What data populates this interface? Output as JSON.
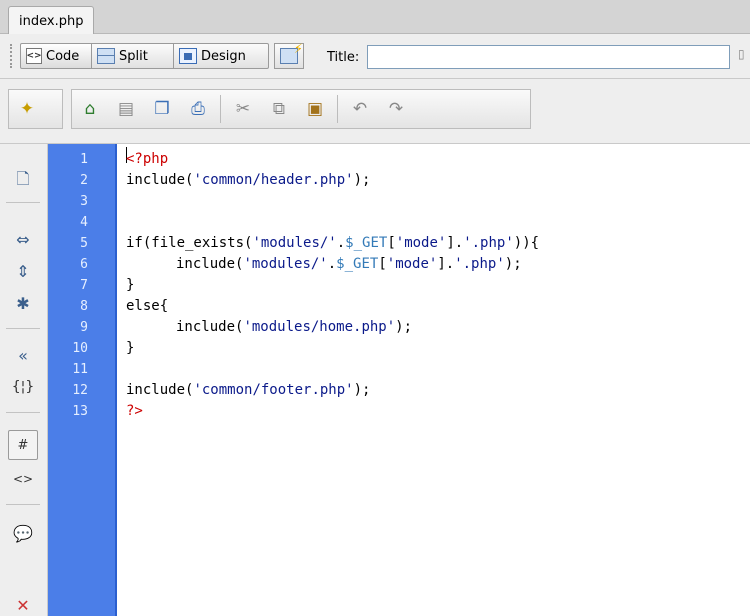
{
  "document": {
    "tab_label": "index.php"
  },
  "view_toolbar": {
    "code_label": "Code",
    "split_label": "Split",
    "design_label": "Design",
    "title_label": "Title:",
    "title_value": ""
  },
  "editor": {
    "lines": [
      {
        "number": "1",
        "text": "<?php"
      },
      {
        "number": "2",
        "text": "include('common/header.php');"
      },
      {
        "number": "3",
        "text": ""
      },
      {
        "number": "4",
        "text": ""
      },
      {
        "number": "5",
        "text": "if(file_exists('modules/'.$_GET['mode'].'.php')){"
      },
      {
        "number": "6",
        "text": "include('modules/'.$_GET['mode'].'.php');"
      },
      {
        "number": "7",
        "text": "}"
      },
      {
        "number": "8",
        "text": "else{"
      },
      {
        "number": "9",
        "text": "include('modules/home.php');"
      },
      {
        "number": "10",
        "text": "}"
      },
      {
        "number": "11",
        "text": ""
      },
      {
        "number": "12",
        "text": "include('common/footer.php');"
      },
      {
        "number": "13",
        "text": "?>"
      }
    ]
  },
  "colors": {
    "gutter_background": "#4b7ee8",
    "php_tag": "#cc0000",
    "string": "#0b1a8a",
    "variable": "#337ab7"
  },
  "icons": {
    "toolbar": [
      "new-document-icon",
      "home-icon",
      "file-management-icon",
      "save-all-icon",
      "print-icon",
      "cut-icon",
      "copy-icon",
      "paste-icon",
      "undo-icon",
      "redo-icon"
    ],
    "sidebar": [
      "open-documents-icon",
      "collapse-full-tag-icon",
      "collapse-selection-icon",
      "expand-all-icon",
      "select-parent-tag-icon",
      "balance-braces-icon",
      "line-numbers-icon",
      "highlight-invalid-code-icon",
      "apply-comment-icon",
      "remove-comment-icon"
    ]
  }
}
